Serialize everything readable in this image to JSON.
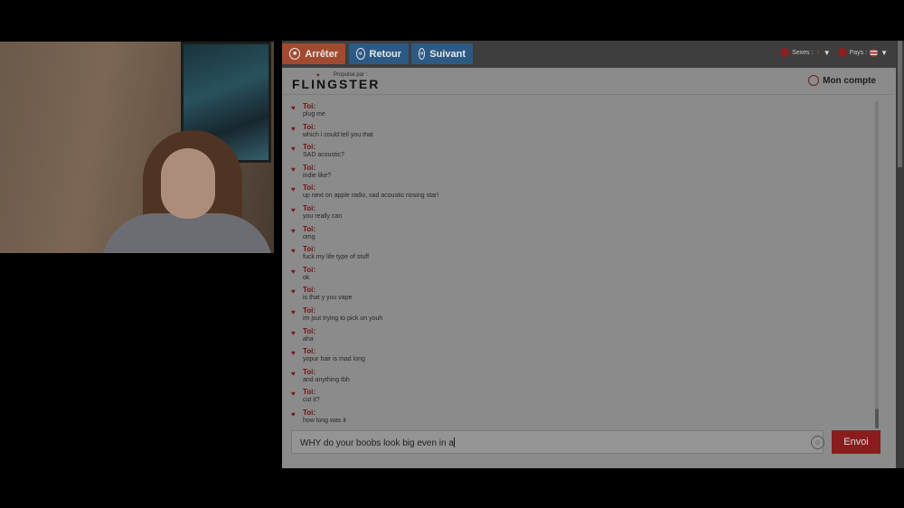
{
  "toolbar": {
    "stop_label": "Arrêter",
    "back_label": "Retour",
    "next_label": "Suivant",
    "sexes_label": "Sexes :",
    "country_label": "Pays :"
  },
  "brand": {
    "powered_by": "Propulsé par :",
    "logo": "FLINGSTER",
    "account_label": "Mon compte"
  },
  "messages": [
    {
      "sender": "Toi:",
      "text": "plug me"
    },
    {
      "sender": "Toi:",
      "text": "which i could tell you that"
    },
    {
      "sender": "Toi:",
      "text": "SAD acoustic?"
    },
    {
      "sender": "Toi:",
      "text": "indie like?"
    },
    {
      "sender": "Toi:",
      "text": "up next on apple radio, sad acoustic riosing star!"
    },
    {
      "sender": "Toi:",
      "text": "you really can"
    },
    {
      "sender": "Toi:",
      "text": "omg"
    },
    {
      "sender": "Toi:",
      "text": "fuck my life type of stuff"
    },
    {
      "sender": "Toi:",
      "text": "ok"
    },
    {
      "sender": "Toi:",
      "text": "is that y you vape"
    },
    {
      "sender": "Toi:",
      "text": "im jsut trying to pick on youh"
    },
    {
      "sender": "Toi:",
      "text": "aha"
    },
    {
      "sender": "Toi:",
      "text": "yopur hair is mad long"
    },
    {
      "sender": "Toi:",
      "text": "and anything tbh"
    },
    {
      "sender": "Toi:",
      "text": "cut it?"
    },
    {
      "sender": "Toi:",
      "text": "how long was it"
    }
  ],
  "compose": {
    "value": "WHY do your boobs look big even in a",
    "send_label": "Envoi"
  },
  "colors": {
    "stop": "#a24a2f",
    "nav": "#2d5a84",
    "accent": "#891d1d"
  }
}
